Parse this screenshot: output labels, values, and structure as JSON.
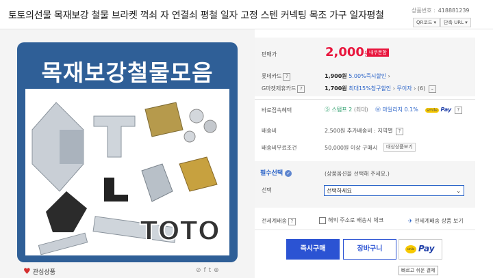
{
  "header": {
    "title": "토토의선물 목재보강 철물 브라켓 꺽쇠 자 연결쇠 평철 일자 고정 스텐 커넥팅 목조 가구 일자평철",
    "product_no_label": "상품번호 :",
    "product_no": "418881239",
    "qr_label": "QR코드",
    "short_url_label": "단축 URL"
  },
  "image": {
    "caption": "목재보강철물모음",
    "brand": "TOTO"
  },
  "footer_left": {
    "wish_label": "관심상품"
  },
  "price": {
    "label": "판매가",
    "amount": "2,000",
    "unit": "원",
    "badge": "내쿠폰함"
  },
  "card": {
    "lotte_label": "롯데카드",
    "lotte_amount": "1,900원",
    "lotte_discount": "5.00%즉시할인",
    "gmarket_label": "G마켓제휴카드",
    "gmarket_amount": "1,700원",
    "gmarket_discount": "최대15%청구할인",
    "installment": "무이자",
    "installment_count": "(6)"
  },
  "benefits": {
    "label": "바로접속혜택",
    "stamp": "스탬프 2",
    "stamp_max": "(최대)",
    "mileage": "마일리지 0.1%",
    "smilepay": "Pay"
  },
  "shipping": {
    "label": "배송비",
    "value": "2,500원 추가배송비 : 지역별",
    "free_label": "배송비무료조건",
    "free_value": "50,000원 이상 구매시",
    "free_button": "대상상품보기"
  },
  "options": {
    "required_label": "필수선택",
    "hint": "(상품옵션을 선택해 주세요.)",
    "select_label": "선택",
    "select_value": "선택하세요"
  },
  "global": {
    "label": "전세계배송",
    "overseas_check": "해외 주소로 배송시 체크",
    "global_view": "전세계배송 상품 보기"
  },
  "actions": {
    "buy": "즉시구매",
    "cart": "장바구니",
    "smile_logo": "smile",
    "smile_pay": "Pay",
    "tip": "빠르고 쉬운 결제"
  },
  "colors": {
    "accent_blue": "#2b53d3",
    "price_red": "#e8163d",
    "image_bg": "#2f5f97"
  }
}
